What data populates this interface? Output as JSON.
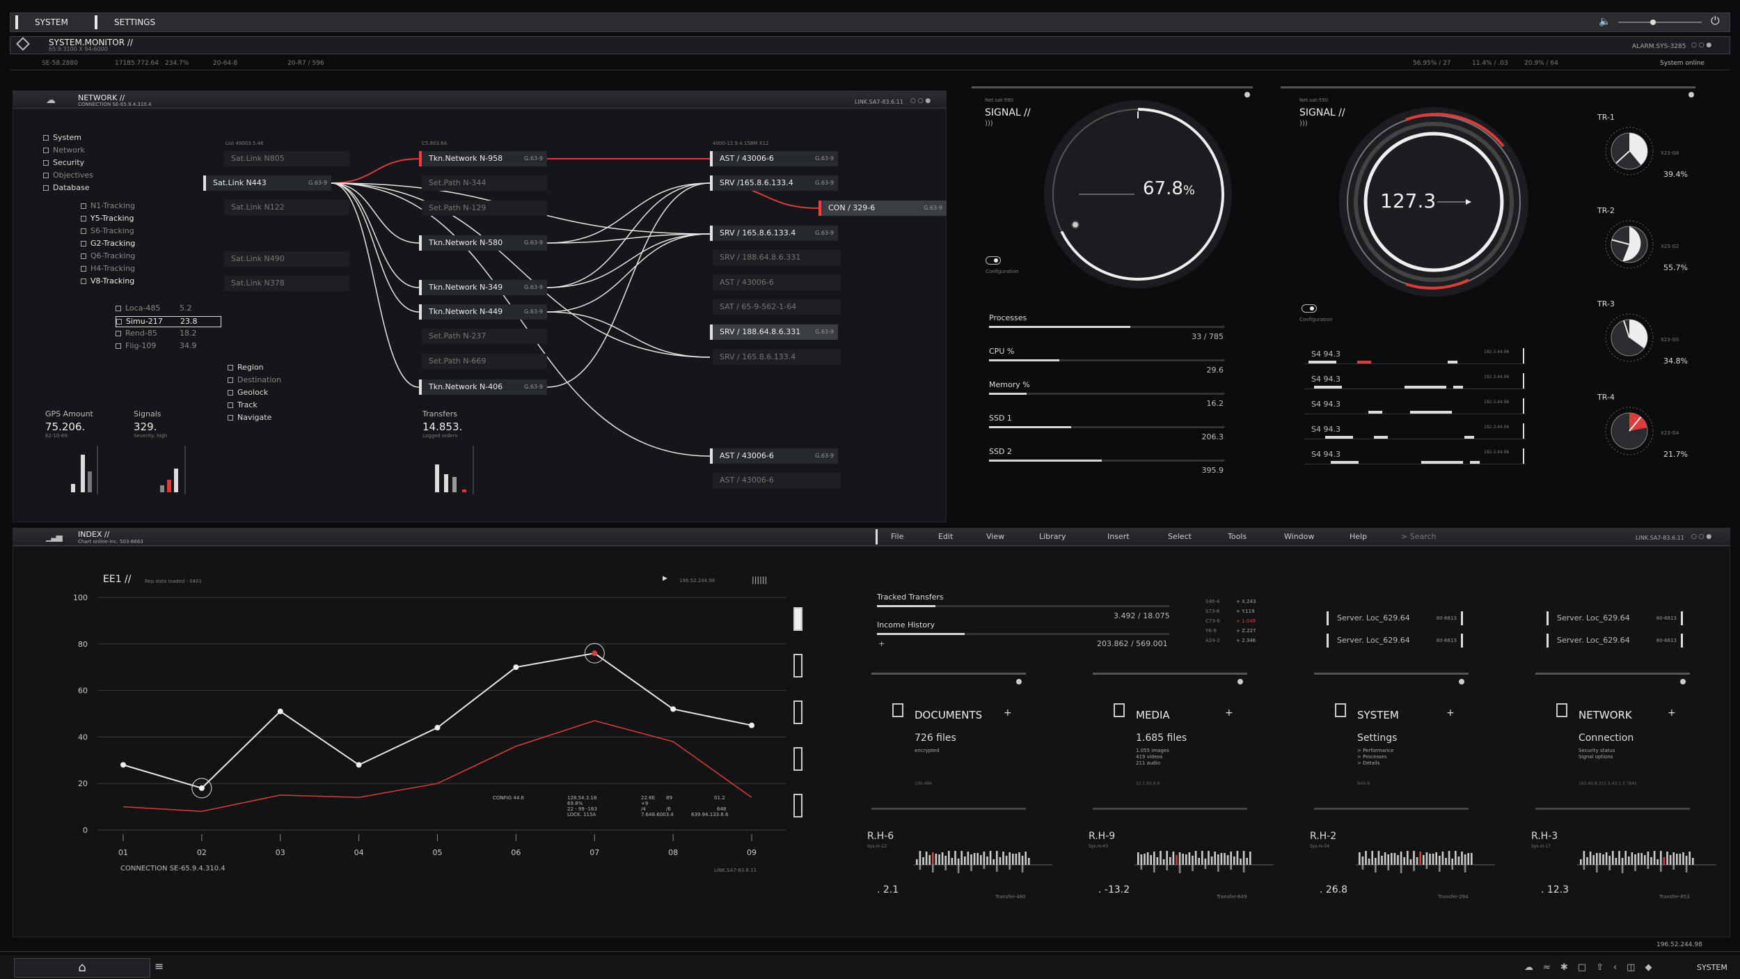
{
  "topbar": {
    "tab1": "SYSTEM",
    "tab2": "SETTINGS"
  },
  "monitor": {
    "title": "SYSTEM.MONITOR //",
    "sub": "65.9.3100 X 94-6000",
    "alarm": "ALARM.SYS-3285"
  },
  "statusline": {
    "a": "SE-58.2880",
    "b": "17185.772.64",
    "c": "234.7%",
    "d": "20-64-8",
    "e": "20-R7 / 596",
    "f": "56.95% / 27",
    "g": "11.4% / .03",
    "h": "20.9% / 64",
    "online": "System online"
  },
  "network": {
    "title": "NETWORK //",
    "sub": "CONNECTION SE-65.9.4.310.4",
    "link": "LINK.SA7-83.6.11",
    "tree": [
      "System",
      "Network",
      "Security",
      "Objectives",
      "Database"
    ],
    "tracking": [
      "N1-Tracking",
      "Y5-Tracking",
      "S6-Tracking",
      "G2-Tracking",
      "Q6-Tracking",
      "H4-Tracking",
      "V8-Tracking"
    ],
    "leaves": [
      {
        "n": "Loca-485",
        "v": "5.2"
      },
      {
        "n": "Simu-217",
        "v": "23.8"
      },
      {
        "n": "Rend-85",
        "v": "18.2"
      },
      {
        "n": "Flig-109",
        "v": "34.9"
      }
    ],
    "region": [
      "Region",
      "Destination",
      "Geolock",
      "Track",
      "Navigate"
    ],
    "col1_head": "List 49003.5.46",
    "col2_head": "C5.803.6A",
    "col3_head": "4000-12.9.4.15BM X12",
    "col1": [
      "Sat.Link N805",
      "Sat.Link N443",
      "Sat.Link N122",
      "Sat.Link N490",
      "Sat.Link N378"
    ],
    "col2": [
      "Tkn.Network N-958",
      "Set.Path N-344",
      "Set.Path N-129",
      "Tkn.Network N-580",
      "Tkn.Network N-349",
      "Tkn.Network N-449",
      "Set.Path N-237",
      "Set.Path N-669",
      "Tkn.Network N-406"
    ],
    "col3": [
      "AST / 43006-6",
      "SRV /165.8.6.133.4",
      "SRV / 165.8.6.133.4",
      "SRV / 188.64.8.6.331",
      "AST / 43006-6",
      "SAT / 65-9-562-1-64",
      "SRV / 188.64.8.6.331",
      "SRV / 165.8.6.133.4",
      "AST / 43006-6",
      "AST / 43006-6"
    ],
    "con": "CON / 329-6",
    "code": "G.63-9",
    "gps_label": "GPS Amount",
    "gps_value": "75.206.",
    "gps_sub": "62-10-69",
    "signals_label": "Signals",
    "signals_value": "329.",
    "signals_sub": "Severity: high",
    "transfers_label": "Transfers",
    "transfers_value": "14.853.",
    "transfers_sub": "Logged orders"
  },
  "signal1": {
    "net": "Net.sat-590",
    "title": "SIGNAL //",
    "value": "67.8",
    "unit": "%",
    "cfg": "Configuration",
    "gauge_frac": 0.678
  },
  "signal2": {
    "net": "Net.sat-590",
    "title": "SIGNAL //",
    "value": "127.3",
    "cfg": "Configuration"
  },
  "metrics": [
    {
      "label": "Processes",
      "value": "33 / 785",
      "frac": 0.6
    },
    {
      "label": "CPU %",
      "value": "29.6",
      "frac": 0.3
    },
    {
      "label": "Memory %",
      "value": "16.2",
      "frac": 0.16
    },
    {
      "label": "SSD 1",
      "value": "206.3",
      "frac": 0.35
    },
    {
      "label": "SSD 2",
      "value": "395.9",
      "frac": 0.48
    }
  ],
  "s4rows": {
    "label": "S4 94.3",
    "code": "192.3.44.96"
  },
  "tr": [
    {
      "name": "TR-1",
      "code": "X23-G8",
      "pct": "39.4%"
    },
    {
      "name": "TR-2",
      "code": "X23-G2",
      "pct": "55.7%"
    },
    {
      "name": "TR-3",
      "code": "X23-G5",
      "pct": "34.8%"
    },
    {
      "name": "TR-4",
      "code": "X23-G4",
      "pct": "21.7%"
    }
  ],
  "index": {
    "title": "INDEX //",
    "sub": "Chart online-inc. 503-8663",
    "link": "LINK.SA7-83.6.11"
  },
  "menu": [
    "File",
    "Edit",
    "View",
    "Library",
    "Insert",
    "Select",
    "Tools",
    "Window",
    "Help",
    "> Search"
  ],
  "chart_header": {
    "title": "EE1 //",
    "sub": "Rep.data loaded - 0401",
    "ip": "196.52.244.98"
  },
  "chart_foot": {
    "left": "CONNECTION SE-65.9.4.310.4",
    "right": "LINK.SA7-83.6.11"
  },
  "chart_notes": [
    "CONFIG 44.6",
    "128.54.3.18",
    "69.8%",
    "22 - 99 -163",
    "LOCK. 115A",
    "22.6E",
    "+9",
    "/4",
    "7.648.6003.4",
    "89",
    "/6",
    "01.2",
    "648",
    "639.94.133.8.6"
  ],
  "chart_data": {
    "type": "line",
    "x": [
      "01",
      "02",
      "03",
      "04",
      "05",
      "06",
      "07",
      "08",
      "09"
    ],
    "yticks": [
      "0",
      "20",
      "40",
      "60",
      "80",
      "100"
    ],
    "ylim": [
      0,
      100
    ],
    "series": [
      {
        "values": [
          28,
          18,
          51,
          28,
          44,
          70,
          76,
          52,
          45
        ],
        "color": "#e8e8e8"
      },
      {
        "values": [
          10,
          8,
          15,
          14,
          20,
          36,
          47,
          38,
          14
        ],
        "color": "#e03b3b"
      }
    ]
  },
  "transfers": {
    "tracked_label": "Tracked Transfers",
    "tracked_value": "3.492 / 18.075",
    "tracked_frac": 0.2,
    "income_label": "Income History",
    "income_value": "203.862 / 569.001",
    "income_frac": 0.3,
    "mini": [
      "S46-4",
      "S73-6",
      "C73-6",
      "Y6-9",
      "A24-2"
    ],
    "mini_v": [
      "+ X.243",
      "+ Y.119",
      "+ 1.049",
      "+ Z.227",
      "+ 2.346"
    ]
  },
  "servers": {
    "label": "Server. Loc_629.64",
    "code": "80-6613"
  },
  "cards": [
    {
      "title": "DOCUMENTS",
      "value": "726 files",
      "sub": [
        "encrypted"
      ],
      "foot": "195-486"
    },
    {
      "title": "MEDIA",
      "value": "1.685 files",
      "sub": [
        "1.055 images",
        "419 videos",
        "211 audio"
      ],
      "foot": "32.1.85.6.9"
    },
    {
      "title": "SYSTEM",
      "value": "Settings",
      "sub": [
        "> Performance",
        "> Processes",
        "> Details"
      ],
      "foot": "N45-9"
    },
    {
      "title": "NETWORK",
      "value": "Connection",
      "sub": [
        "Security status",
        "Signal options"
      ],
      "foot": "162.45.8.311.5.43.1.5.7841"
    }
  ],
  "rh": [
    {
      "name": "R.H-6",
      "sys": "Sys.m-22",
      "val": ". 2.1",
      "tr": "Transfer-480"
    },
    {
      "name": "R.H-9",
      "sys": "Sys.m-43",
      "val": ". -13.2",
      "tr": "Transfer-649"
    },
    {
      "name": "R.H-2",
      "sys": "Sys.m-34",
      "val": ". 26.8",
      "tr": "Transfer-294"
    },
    {
      "name": "R.H-3",
      "sys": "Sys.m-17",
      "val": ". 12.3",
      "tr": "Transfer-853"
    }
  ],
  "bottom": {
    "ip": "196.52.244.98",
    "system": "SYSTEM"
  }
}
